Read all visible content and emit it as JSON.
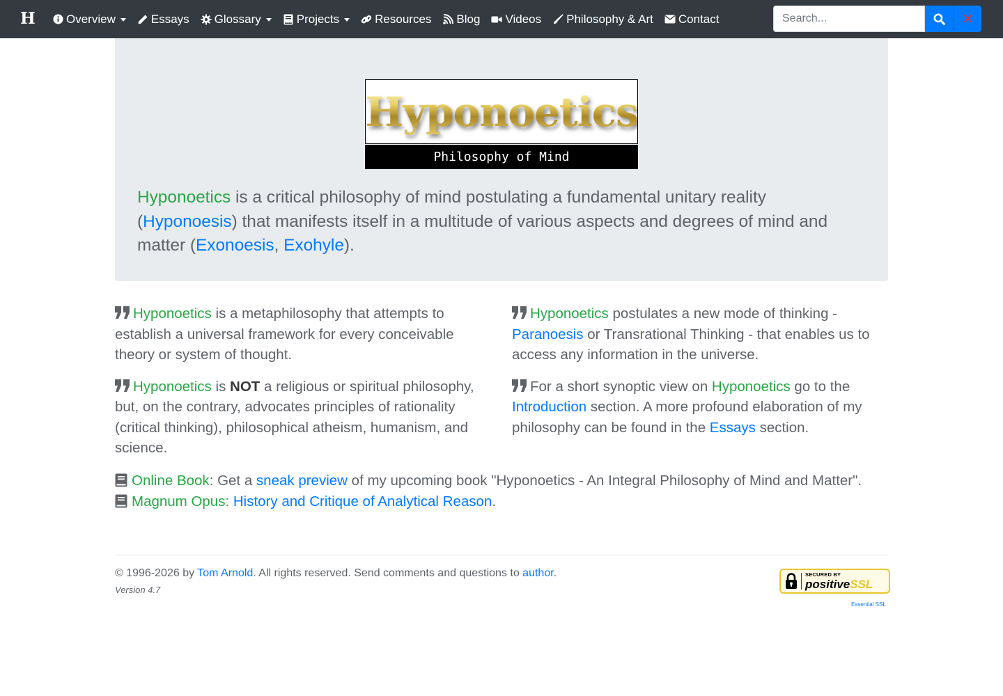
{
  "nav": {
    "brand": "H",
    "items": [
      {
        "label": "Overview",
        "icon": "info-circle-icon",
        "dropdown": true
      },
      {
        "label": "Essays",
        "icon": "pencil-icon",
        "dropdown": false
      },
      {
        "label": "Glossary",
        "icon": "gear-icon",
        "dropdown": true
      },
      {
        "label": "Projects",
        "icon": "book-icon",
        "dropdown": true
      },
      {
        "label": "Resources",
        "icon": "link-icon",
        "dropdown": false
      },
      {
        "label": "Blog",
        "icon": "rss-icon",
        "dropdown": false
      },
      {
        "label": "Videos",
        "icon": "video-camera-icon",
        "dropdown": false
      },
      {
        "label": "Philosophy & Art",
        "icon": "paintbrush-icon",
        "dropdown": false
      },
      {
        "label": "Contact",
        "icon": "envelope-icon",
        "dropdown": false
      }
    ],
    "search_placeholder": "Search...",
    "search_value": "",
    "clear_label": "✕"
  },
  "hero": {
    "logo_text": "Hyponoetics",
    "logo_subtitle": "Philosophy of Mind",
    "lead": {
      "t1": "Hyponoetics",
      "t2": " is a critical philosophy of mind postulating a fundamental unitary reality (",
      "t3": "Hyponoesis",
      "t4": ") that manifests itself in a multitude of various aspects and degrees of mind and matter (",
      "t5": "Exonoesis",
      "t6": ", ",
      "t7": "Exohyle",
      "t8": ")."
    }
  },
  "left_col": {
    "p1": {
      "a": "Hyponoetics",
      "b": " is a metaphilosophy that attempts to establish a universal framework for every conceivable theory or system of thought."
    },
    "p2": {
      "a": "Hyponoetics",
      "b": " is ",
      "c": "NOT",
      "d": " a religious or spiritual philosophy, but, on the contrary, advocates principles of rationality (critical thinking), philosophical atheism, humanism, and science."
    }
  },
  "right_col": {
    "p1": {
      "a": "Hyponoetics",
      "b": " postulates a new mode of thinking - ",
      "c": "Paranoesis",
      "d": " or Transrational Thinking - that enables us to access any information in the universe."
    },
    "p2": {
      "a": "For a short synoptic view on ",
      "b": "Hyponoetics",
      "c": " go to the ",
      "d": "Introduction",
      "e": " section. A more profound elaboration of my philosophy can be found in the ",
      "f": "Essays",
      "g": " section."
    }
  },
  "books": {
    "b1": {
      "a": "Online Book",
      "b": ": Get a ",
      "c": "sneak preview",
      "d": " of my upcoming book \"Hyponoetics - An Integral Philosophy of Mind and Matter\"."
    },
    "b2": {
      "a": "Magnum Opus: ",
      "b": "History and Critique of Analytical Reason",
      "c": "."
    }
  },
  "footer": {
    "copy_a": "© 1996-2026 by ",
    "author_name": "Tom Arnold",
    "copy_b": ". All rights reserved. Send comments and questions to ",
    "author_link": "author",
    "copy_c": ".",
    "version": "Version 4.7",
    "ssl_small": "SECURED BY",
    "ssl_big_a": "positive",
    "ssl_big_b": "SSL",
    "ssl_caption": "Essential SSL"
  },
  "colors": {
    "navbar": "#343a40",
    "primary": "#007bff",
    "link_green": "#28a745",
    "jumbotron": "#e9ecef",
    "danger": "#dc3545"
  }
}
